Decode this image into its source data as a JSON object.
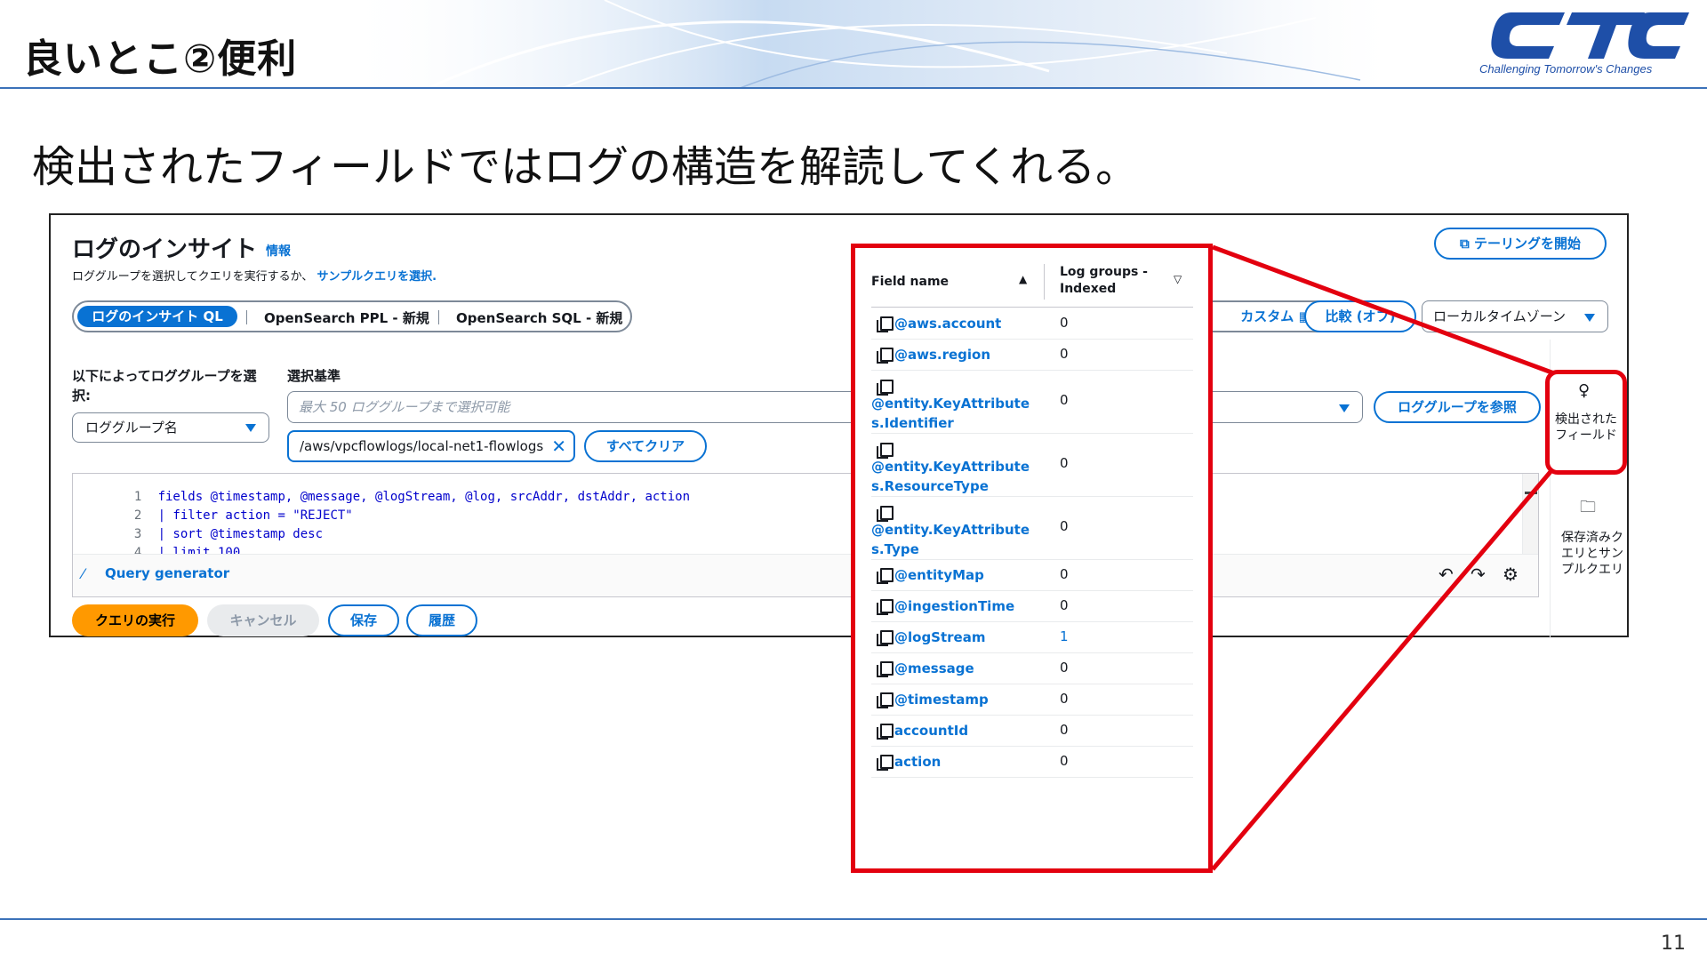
{
  "slide": {
    "title": "良いとこ②便利",
    "subtitle": "検出されたフィールドではログの構造を解読してくれる。",
    "page_number": "11",
    "logo_text": "Challenging Tomorrow's Changes",
    "logo_name": "ctc-logo"
  },
  "console": {
    "title": "ログのインサイト",
    "info_link": "情報",
    "description": "ロググループを選択してクエリを実行するか、",
    "sample_link": "サンプルクエリを選択.",
    "tail_button": "テーリングを開始",
    "tabs": {
      "active": "ログのインサイト QL",
      "ppl": "OpenSearch PPL - 新規",
      "sql": "OpenSearch SQL - 新規"
    },
    "custom_label": "カスタム",
    "compare_button": "比較 (オフ)",
    "timezone": "ローカルタイムゾーン",
    "select_by_label": "以下によってロググループを選択:",
    "select_by_value": "ロググループ名",
    "criteria_label": "選択基準",
    "criteria_placeholder": "最大 50 ロググループまで選択可能",
    "browse_button": "ロググループを参照",
    "token": "/aws/vpcflowlogs/local-net1-flowlogs",
    "clear_all": "すべてクリア",
    "query_lines": [
      "fields @timestamp, @message, @logStream, @log, srcAddr, dstAddr, action",
      "| filter action = \"REJECT\"",
      "| sort @timestamp desc",
      "| limit 100"
    ],
    "query_generator": "Query generator",
    "run_button": "クエリの実行",
    "cancel_button": "キャンセル",
    "save_button": "保存",
    "history_button": "履歴",
    "rail_discovered": "検出されたフィールド",
    "rail_saved": "保存済みクエリとサンプルクエリ"
  },
  "fields_panel": {
    "col_name": "Field name",
    "col_groups": "Log groups - Indexed",
    "rows": [
      {
        "name": "@aws.account",
        "value": "0"
      },
      {
        "name": "@aws.region",
        "value": "0"
      },
      {
        "name": "@entity.KeyAttributes.Identifier",
        "value": "0"
      },
      {
        "name": "@entity.KeyAttributes.ResourceType",
        "value": "0"
      },
      {
        "name": "@entity.KeyAttributes.Type",
        "value": "0"
      },
      {
        "name": "@entityMap",
        "value": "0"
      },
      {
        "name": "@ingestionTime",
        "value": "0"
      },
      {
        "name": "@logStream",
        "value": "1"
      },
      {
        "name": "@message",
        "value": "0"
      },
      {
        "name": "@timestamp",
        "value": "0"
      },
      {
        "name": "accountId",
        "value": "0"
      },
      {
        "name": "action",
        "value": "0"
      }
    ]
  },
  "colors": {
    "accent": "#0972d3",
    "primary_button": "#ff9900",
    "highlight": "#e3000f",
    "slide_rule": "#3c72b9"
  }
}
